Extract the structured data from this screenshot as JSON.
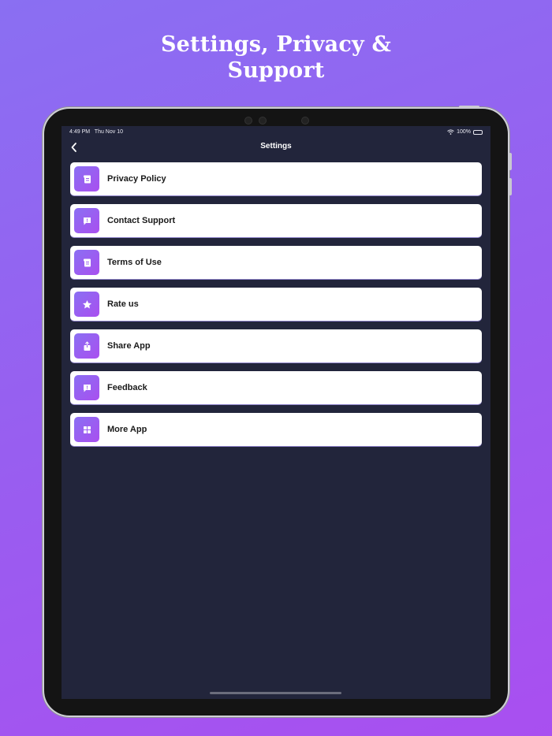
{
  "headline": {
    "line1": "Settings, Privacy &",
    "line2": "Support"
  },
  "status_bar": {
    "time": "4:49 PM",
    "date": "Thu Nov 10",
    "battery": "100%"
  },
  "nav": {
    "title": "Settings"
  },
  "menu": [
    {
      "label": "Privacy Policy",
      "icon": "document-icon"
    },
    {
      "label": "Contact Support",
      "icon": "message-alert-icon"
    },
    {
      "label": "Terms of Use",
      "icon": "document-icon"
    },
    {
      "label": "Rate us",
      "icon": "star-icon"
    },
    {
      "label": "Share App",
      "icon": "share-icon"
    },
    {
      "label": "Feedback",
      "icon": "message-alert-icon"
    },
    {
      "label": "More App",
      "icon": "grid-icon"
    }
  ],
  "colors": {
    "background_start": "#8a6ff2",
    "background_end": "#a94ff0",
    "screen": "#22253b",
    "accent": "#9a5cf0"
  }
}
